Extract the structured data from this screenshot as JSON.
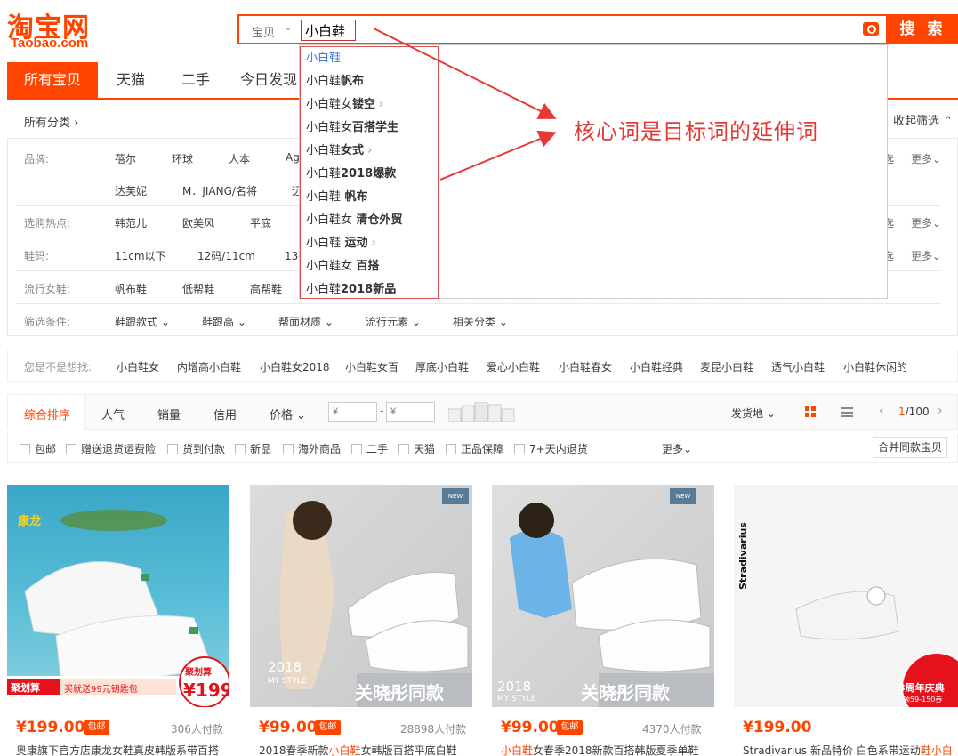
{
  "header": {
    "logo_cn": "淘宝网",
    "logo_en": "Taobao.com",
    "search_category": "宝贝",
    "search_value": "小白鞋",
    "search_button": "搜 索"
  },
  "tabs": [
    "所有宝贝",
    "天猫",
    "二手",
    "今日发现"
  ],
  "suggestions": [
    {
      "base": "小白鞋",
      "extra": ""
    },
    {
      "base": "小白鞋",
      "extra": "帆布"
    },
    {
      "base": "小白鞋女",
      "extra": "镂空",
      "arrow": "›"
    },
    {
      "base": "小白鞋女",
      "extra": "百搭学生"
    },
    {
      "base": "小白鞋",
      "extra": "女式",
      "arrow": "›"
    },
    {
      "base": "小白鞋",
      "extra": "2018爆款"
    },
    {
      "base": "小白鞋",
      "extra": " 帆布"
    },
    {
      "base": "小白鞋女",
      "extra": " 清仓外贸"
    },
    {
      "base": "小白鞋",
      "extra": " 运动",
      "arrow": "›"
    },
    {
      "base": "小白鞋女",
      "extra": " 百搭"
    },
    {
      "base": "小白鞋",
      "extra": "2018新品"
    }
  ],
  "annotation": "核心词是目标词的延伸词",
  "filters": {
    "all_category": "所有分类 ›",
    "collapse": "收起筛选 ⌃",
    "brand_label": "品牌:",
    "brand_row1": [
      "蓓尔",
      "环球",
      "人本",
      "Ag"
    ],
    "brand_row2": [
      "达芙妮",
      "M．JIANG/名将",
      "远"
    ],
    "hot_label": "选购热点:",
    "hot_values": [
      "韩范儿",
      "欧美风",
      "平底"
    ],
    "size_label": "鞋码:",
    "size_values": [
      "11cm以下",
      "12码/11cm",
      "13码"
    ],
    "style_label": "流行女鞋:",
    "style_values": [
      "帆布鞋",
      "低帮鞋",
      "高帮鞋"
    ],
    "cond_label": "筛选条件:",
    "cond_values": [
      "鞋跟款式 ⌄",
      "鞋跟高 ⌄",
      "帮面材质 ⌄",
      "流行元素 ⌄",
      "相关分类 ⌄"
    ],
    "more": "更多⌄",
    "multi": "选"
  },
  "related": {
    "label": "您是不是想找:",
    "items": [
      "小白鞋女",
      "内增高小白鞋",
      "小白鞋女2018",
      "小白鞋女百",
      "厚底小白鞋",
      "爱心小白鞋",
      "小白鞋春女",
      "小白鞋经典",
      "麦昆小白鞋",
      "透气小白鞋",
      "小白鞋休闲的"
    ]
  },
  "sortbar": {
    "items": [
      "综合排序",
      "人气",
      "销量",
      "信用",
      "价格 ⌄"
    ],
    "price_min_placeholder": "¥",
    "price_max_placeholder": "¥",
    "price_dash": "-",
    "ship_from": "发货地 ⌄",
    "page_current": "1",
    "page_total": "/100",
    "prev": "‹",
    "next": "›"
  },
  "checkboxes": [
    "包邮",
    "赠送退货运费险",
    "货到付款",
    "新品",
    "海外商品",
    "二手",
    "天猫",
    "正品保障",
    "7+天内退货"
  ],
  "more_options": "更多⌄",
  "merge_button": "合并同款宝贝",
  "products": [
    {
      "price": "¥199.00",
      "tag": "包邮",
      "count": "306人付款",
      "title_pre": "奥康旗下官方店康龙女鞋真皮韩版系带百搭",
      "title_hl": "",
      "badge_brand": "康龙",
      "badge_top": "聚划算",
      "badge_sale": "聚划算",
      "badge_price": "¥199",
      "badge_coupon": "买就送99元钥匙包"
    },
    {
      "price": "¥99.00",
      "tag": "包邮",
      "count": "28898人付款",
      "title_pre": "2018春季新款",
      "title_hl": "小白鞋",
      "title_post": "女韩版百搭平底白鞋",
      "caption": "关晓彤同款",
      "year": "2018",
      "style": "MY STYLE",
      "new": "NEW"
    },
    {
      "price": "¥99.00",
      "tag": "包邮",
      "count": "4370人付款",
      "title_pre": "",
      "title_hl": "小白鞋",
      "title_post": "女春季2018新款百搭韩版夏季单鞋",
      "caption": "关晓彤同款",
      "year": "2018",
      "style": "MY STYLE",
      "new": "NEW"
    },
    {
      "price": "¥199.00",
      "tag": "",
      "count": "",
      "title_pre": "Stradivarius 新品特价 白色系带运动",
      "title_hl": "鞋小白",
      "title_post": "",
      "brand": "Stradivarius",
      "promo": "3周年庆典",
      "promo_sub": "领59-150券"
    }
  ],
  "colors": {
    "accent": "#ff4400",
    "annotation": "#e53935"
  }
}
